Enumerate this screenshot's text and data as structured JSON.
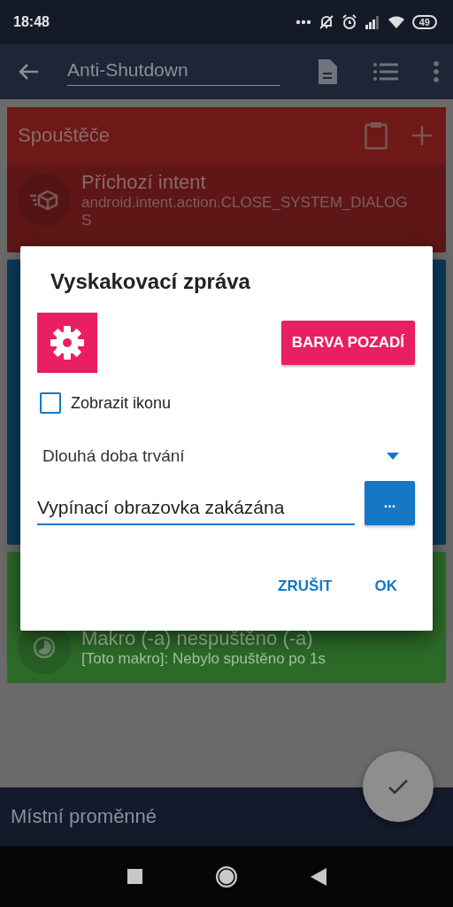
{
  "status_bar": {
    "time": "18:48",
    "battery": "49"
  },
  "toolbar": {
    "title": "Anti-Shutdown"
  },
  "triggers": {
    "title": "Spouštěče",
    "items": [
      {
        "title": "Příchozí intent",
        "detail": "android.intent.action.CLOSE_SYSTEM_DIALOGS"
      }
    ]
  },
  "constraints": {
    "items": [
      {
        "title": "Makro (-a) nespuštěno (-a)",
        "detail": "[Toto makro]: Nebylo spuštěno po 1s"
      }
    ]
  },
  "dialog": {
    "title": "Vyskakovací zpráva",
    "background_button": "BARVA POZADÍ",
    "show_icon": {
      "label": "Zobrazit ikonu",
      "checked": false
    },
    "duration": {
      "value": "Dlouhá doba trvání"
    },
    "message": {
      "value": "Vypínací obrazovka zakázána"
    },
    "more_button": "...",
    "buttons": [
      {
        "label": "ZRUŠIT"
      },
      {
        "label": "OK"
      }
    ]
  },
  "bottom_bar": {
    "title": "Místní proměnné"
  }
}
